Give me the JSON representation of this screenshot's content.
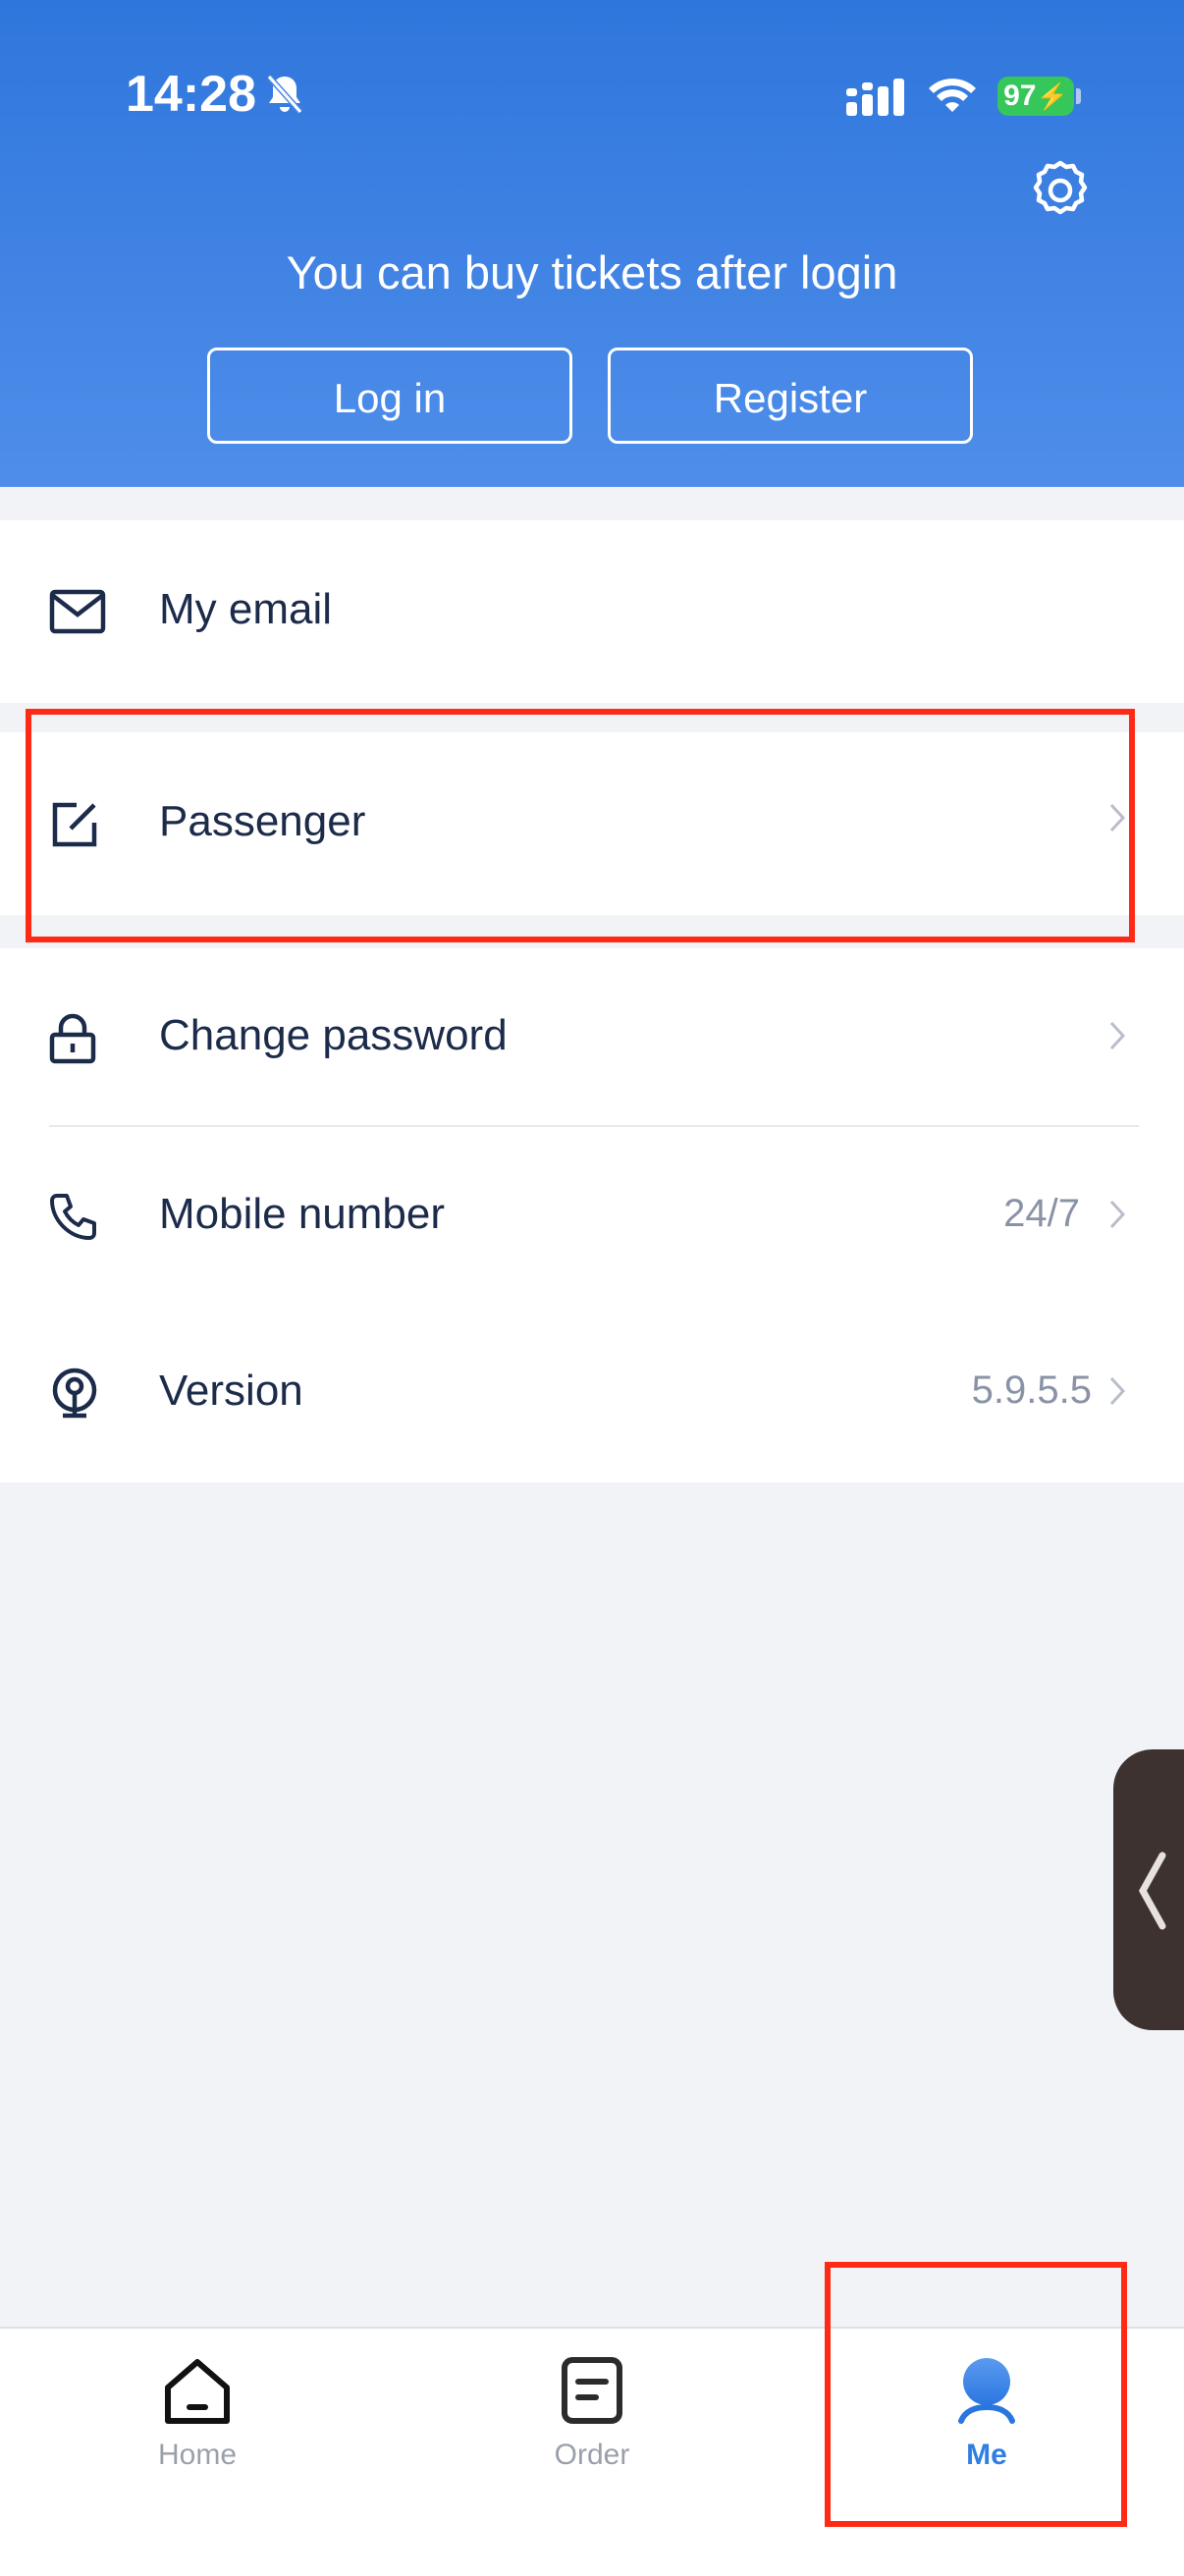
{
  "status_bar": {
    "time": "14:28",
    "battery": "97"
  },
  "header": {
    "login_hint": "You can buy tickets after login",
    "login_label": "Log in",
    "register_label": "Register"
  },
  "menu": {
    "items": [
      {
        "label": "My email",
        "icon": "mail-icon",
        "value": ""
      },
      {
        "label": "Passenger",
        "icon": "edit-icon",
        "value": ""
      },
      {
        "label": "Change password",
        "icon": "lock-icon",
        "value": ""
      },
      {
        "label": "Mobile number",
        "icon": "phone-icon",
        "value": "24/7"
      },
      {
        "label": "Version",
        "icon": "train-logo-icon",
        "value": "5.9.5.5"
      }
    ]
  },
  "tabbar": {
    "tabs": [
      {
        "label": "Home",
        "icon": "home-icon",
        "active": false
      },
      {
        "label": "Order",
        "icon": "order-icon",
        "active": false
      },
      {
        "label": "Me",
        "icon": "user-icon",
        "active": true
      }
    ]
  },
  "colors": {
    "header_top": "#2f76dc",
    "header_bottom": "#4f8eea",
    "accent": "#2f7fe3",
    "highlight": "#ff2a16",
    "text": "#1c2b4a",
    "muted": "#8a93a6",
    "battery": "#35c759"
  }
}
